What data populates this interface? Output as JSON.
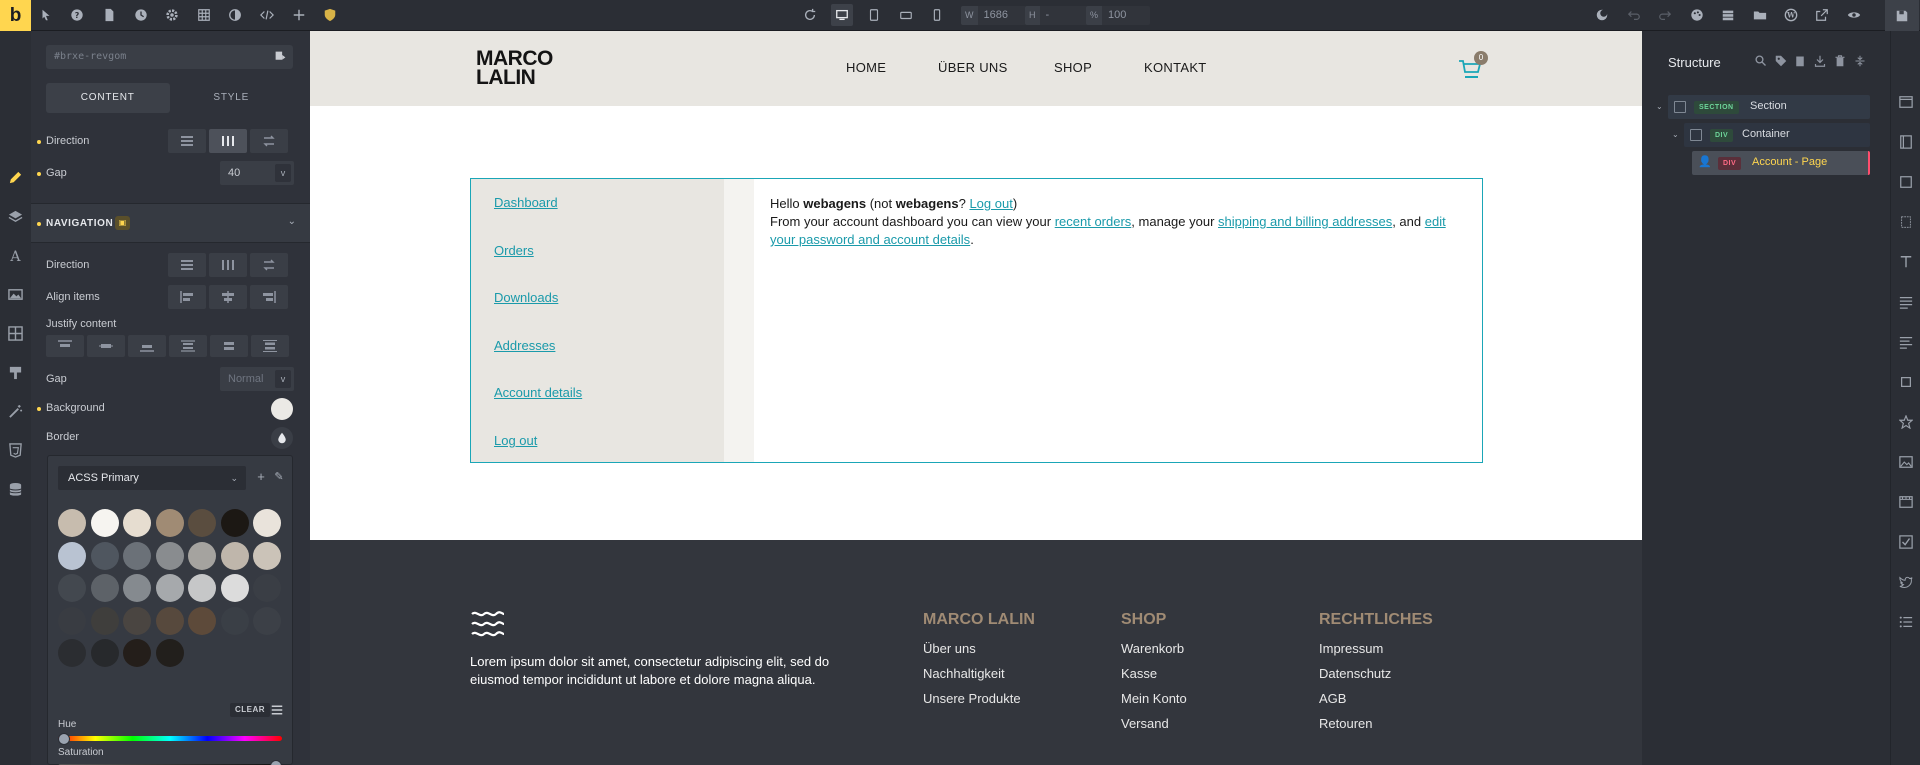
{
  "toolbar": {
    "logo": "b",
    "width_tag": "W",
    "width_value": "1686",
    "height_tag": "H",
    "height_value": "-",
    "zoom_tag": "%",
    "zoom_value": "100"
  },
  "left_panel": {
    "element_id": "#brxe-revgom",
    "tabs": [
      "CONTENT",
      "STYLE"
    ],
    "active_tab": "CONTENT",
    "direction_label": "Direction",
    "gap_label": "Gap",
    "gap_value": "40",
    "gap_unit": "v",
    "navigation_section": "NAVIGATION",
    "nav_direction_label": "Direction",
    "align_items_label": "Align items",
    "justify_content_label": "Justify content",
    "nav_gap_label": "Gap",
    "nav_gap_placeholder": "Normal",
    "nav_gap_unit": "v",
    "background_label": "Background",
    "border_label": "Border",
    "background_color": "#ebe9e5"
  },
  "color_picker": {
    "palette_name": "ACSS Primary",
    "clear_label": "CLEAR",
    "hue_label": "Hue",
    "saturation_label": "Saturation",
    "swatch_rows": [
      [
        "#c7bcae",
        "#f6f4f0",
        "#e6ddd0",
        "#a08b74",
        "#5a4d3f",
        "#1c1814",
        "#e9e3db"
      ],
      [
        "#b9c3d2",
        "#4f565f",
        "#6b7178",
        "#898c8f",
        "#a5a39f",
        "#bfb6ab",
        "#cbc3b8"
      ],
      [
        "#43484f",
        "#5d6268",
        "#858a8f",
        "#a6a9ac",
        "#c6c7c8",
        "#dcdcdc",
        "#3a3e45"
      ],
      [
        "#393c42",
        "#3f3e3c",
        "#4a4541",
        "#57493d",
        "#5d4a3a",
        "#3a3f46",
        "#3c4047"
      ],
      [
        "#2b2d31",
        "#27292c",
        "#241e1a",
        "#221f1c"
      ]
    ]
  },
  "site": {
    "brand_line1": "MARCO",
    "brand_line2": "LALIN",
    "nav": [
      "HOME",
      "ÜBER UNS",
      "SHOP",
      "KONTAKT"
    ],
    "cart_count": "0",
    "account_nav": [
      "Dashboard",
      "Orders",
      "Downloads",
      "Addresses",
      "Account details",
      "Log out"
    ],
    "account_text": {
      "hello": "Hello ",
      "user": "webagens",
      "not": " (not ",
      "user2": "webagens",
      "q": "? ",
      "logout": "Log out",
      "close": ")",
      "line2_a": "From your account dashboard you can view your ",
      "recent_orders": "recent orders",
      "line2_b": ", manage your ",
      "addresses": "shipping and billing addresses",
      "line2_c": ", and ",
      "edit": "edit your password and account details",
      "period": "."
    },
    "footer_text": "Lorem ipsum dolor sit amet, consectetur adipiscing elit, sed do eiusmod tempor incididunt ut labore et dolore magna aliqua.",
    "footer_cols": [
      {
        "title": "MARCO LALIN",
        "items": [
          "Über uns",
          "Nachhaltigkeit",
          "Unsere Produkte"
        ]
      },
      {
        "title": "SHOP",
        "items": [
          "Warenkorb",
          "Kasse",
          "Mein Konto",
          "Versand"
        ]
      },
      {
        "title": "RECHTLICHES",
        "items": [
          "Impressum",
          "Datenschutz",
          "AGB",
          "Retouren"
        ]
      }
    ]
  },
  "structure": {
    "title": "Structure",
    "tree": [
      {
        "tag": "SECTION",
        "label": "Section"
      },
      {
        "tag": "DIV",
        "label": "Container"
      },
      {
        "tag": "DIV",
        "label": "Account - Page"
      }
    ]
  },
  "colors": {
    "accent": "#ffd64f",
    "link": "#1a9aaa",
    "footer_head": "#a08b74"
  }
}
